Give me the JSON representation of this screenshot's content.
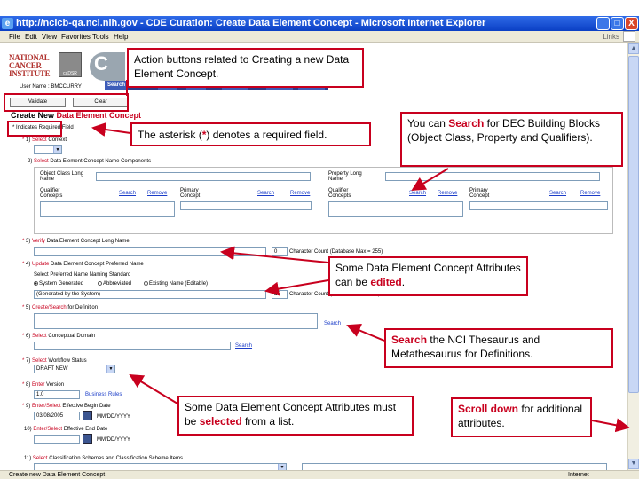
{
  "window": {
    "title": "http://ncicb-qa.nci.nih.gov - CDE Curation: Create Data Element Concept - Microsoft Internet Explorer",
    "minimize": "_",
    "maximize": "□",
    "close": "X"
  },
  "menu": {
    "items": [
      "File",
      "Edit",
      "View",
      "Favorites",
      "Tools",
      "Help"
    ],
    "links": "Links"
  },
  "header": {
    "nci_logo_text": "NATIONAL CANCER INSTITUTE",
    "cadsr_logo_text": "caDSR",
    "search_tab": "Search",
    "user_name": "User Name : BMCCURRY"
  },
  "actions": {
    "validate": "Validate",
    "clear": "Clear"
  },
  "page_title": {
    "prefix": "Create New ",
    "highlight": "Data Element Concept"
  },
  "required_note": "* Indicates Required Field",
  "fields": {
    "f1": {
      "num": "1)",
      "verb": "Select",
      "rest": " Context"
    },
    "f2": {
      "num": "2)",
      "verb": "Select",
      "rest": " Data Element Concept Name Components"
    },
    "object_class_long_name": "Object Class Long Name",
    "property_long_name": "Property Long Name",
    "qualifier_concepts": "Qualifier Concepts",
    "primary_concept": "Primary Concept",
    "search": "Search",
    "remove": "Remove",
    "f3": {
      "num": "3)",
      "verb": "Verify",
      "rest": " Data Element Concept Long Name"
    },
    "long_name_count": "0",
    "long_name_count_label": "Character Count (Database Max = 255)",
    "f4": {
      "num": "4)",
      "verb": "Update",
      "rest": " Data Element Concept Preferred Name"
    },
    "naming_standard_label": "Select Preferred Name Naming Standard",
    "radio_system": "System Generated",
    "radio_abbrev": "Abbreviated",
    "radio_existing": "Existing Name (Editable)",
    "preferred_name_value": "(Generated by the System)",
    "preferred_count": "25",
    "preferred_count_label": "Character Count (Database Max = 30)",
    "f5": {
      "num": "5)",
      "verb": "Create/Search",
      "rest": " for Definition"
    },
    "f6": {
      "num": "6)",
      "verb": "Select",
      "rest": " Conceptual Domain"
    },
    "f7": {
      "num": "7)",
      "verb": "Select",
      "rest": " Workflow Status"
    },
    "workflow_value": "DRAFT NEW",
    "f8": {
      "num": "8)",
      "verb": "Enter",
      "rest": " Version"
    },
    "version_value": "1.0",
    "business_rules": "Business Rules",
    "f9": {
      "num": "9)",
      "verb": "Enter/Select",
      "rest": " Effective Begin Date"
    },
    "begin_date_value": "03/08/2005",
    "date_format": "MM/DD/YYYY",
    "f10": {
      "num": "10)",
      "verb": "Enter/Select",
      "rest": " Effective End Date"
    },
    "f11": {
      "num": "11)",
      "verb": "Select",
      "rest": " Classification Schemes and Classification Scheme Items"
    }
  },
  "callouts": {
    "action_buttons": "Action buttons related to Creating a new Data Element Concept.",
    "asterisk": {
      "pre": "The asterisk (",
      "mark": "*",
      "post": ") denotes a required field."
    },
    "search_dec": {
      "pre": "You can ",
      "bold": "Search",
      "post": " for DEC Building Blocks (Object Class, Property and Qualifiers)."
    },
    "edited": {
      "pre": "Some Data Element Concept Attributes can be ",
      "bold": "edited",
      "post": "."
    },
    "thesaurus": {
      "bold": "Search",
      "post": " the NCI Thesaurus and Metathesaurus for Definitions."
    },
    "selected": {
      "pre": "Some Data Element Concept Attributes must be ",
      "bold": "selected",
      "post": " from a list."
    },
    "scroll": {
      "bold": "Scroll down",
      "post": " for additional attributes."
    }
  },
  "status": {
    "text": "Create new Data Element Concept",
    "zone": "Internet"
  },
  "colors": {
    "accent_red": "#c8001e",
    "link_blue": "#1a3cc8",
    "titlebar_blue": "#0a3fc4"
  }
}
